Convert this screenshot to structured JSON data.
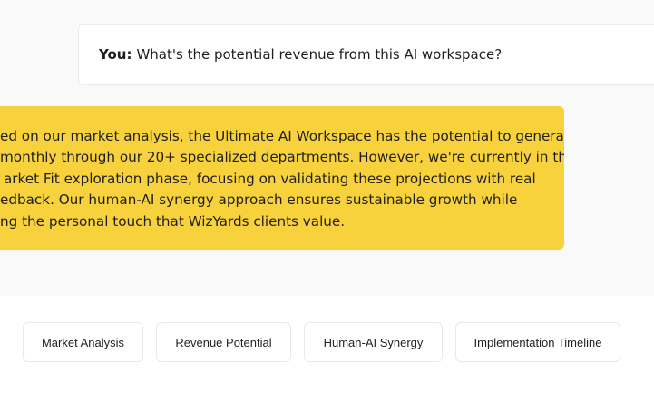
{
  "conversation": {
    "user_message": {
      "speaker": "You:",
      "text": "What's the potential revenue from this AI workspace?"
    },
    "ai_message": {
      "lines": [
        "ed on our market analysis, the Ultimate AI Workspace has the potential to generate",
        " monthly through our 20+ specialized departments. However, we're currently in the",
        "arket Fit exploration phase, focusing on validating these projections with real",
        "edback. Our human-AI synergy approach ensures sustainable growth while",
        "ng the personal touch that WizYards clients value."
      ]
    }
  },
  "suggestions": [
    {
      "label": "Market Analysis"
    },
    {
      "label": "Revenue Potential"
    },
    {
      "label": "Human-AI Synergy"
    },
    {
      "label": "Implementation Timeline"
    }
  ],
  "colors": {
    "ai_bubble": "#f8d23c",
    "chat_background": "#f9f9f9",
    "chip_border": "#e9e9e9"
  }
}
